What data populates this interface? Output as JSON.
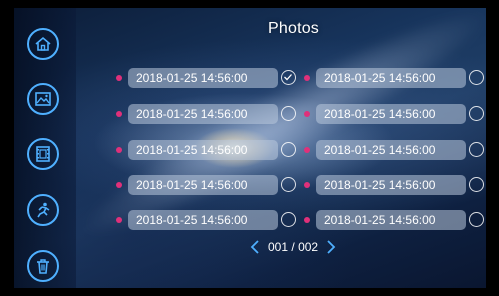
{
  "title": "Photos",
  "sidebar": {
    "items": [
      {
        "icon": "home-icon"
      },
      {
        "icon": "image-icon"
      },
      {
        "icon": "film-icon"
      },
      {
        "icon": "motion-icon"
      },
      {
        "icon": "trash-icon"
      }
    ]
  },
  "photos": {
    "left": [
      {
        "timestamp": "2018-01-25  14:56:00",
        "checked": true
      },
      {
        "timestamp": "2018-01-25  14:56:00",
        "checked": false
      },
      {
        "timestamp": "2018-01-25  14:56:00",
        "checked": false
      },
      {
        "timestamp": "2018-01-25  14:56:00",
        "checked": false
      },
      {
        "timestamp": "2018-01-25  14:56:00",
        "checked": false
      }
    ],
    "right": [
      {
        "timestamp": "2018-01-25  14:56:00",
        "checked": false
      },
      {
        "timestamp": "2018-01-25  14:56:00",
        "checked": false
      },
      {
        "timestamp": "2018-01-25  14:56:00",
        "checked": false
      },
      {
        "timestamp": "2018-01-25  14:56:00",
        "checked": false
      },
      {
        "timestamp": "2018-01-25  14:56:00",
        "checked": false
      }
    ]
  },
  "pagination": {
    "current": "001",
    "total": "002",
    "separator": "/"
  },
  "colors": {
    "accent": "#4fb0ff",
    "dot": "#e0307a"
  }
}
